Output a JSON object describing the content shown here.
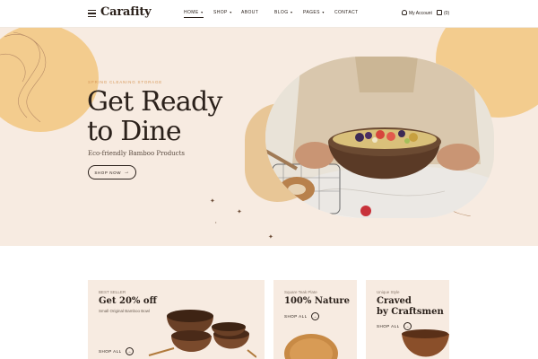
{
  "header": {
    "logo": "Carafity",
    "nav": [
      {
        "label": "HOME",
        "dropdown": true,
        "active": true
      },
      {
        "label": "SHOP",
        "dropdown": true,
        "active": false
      },
      {
        "label": "ABOUT",
        "dropdown": false,
        "active": false
      },
      {
        "label": "BLOG",
        "dropdown": true,
        "active": false
      },
      {
        "label": "PAGES",
        "dropdown": true,
        "active": false
      },
      {
        "label": "CONTACT",
        "dropdown": false,
        "active": false
      }
    ],
    "account_label": "My Account",
    "cart_count": "(0)"
  },
  "hero": {
    "eyebrow": "SPRING CLEANING STORAGE",
    "headline_line1": "Get Ready",
    "headline_line2": "to Dine",
    "subline": "Eco-friendly Bamboo Products",
    "button_label": "SHOP NOW"
  },
  "cards": [
    {
      "label": "BEST SELLER",
      "title": "Get 20% off",
      "desc": "Small Original Bamboo Bowl",
      "button": "SHOP ALL"
    },
    {
      "label": "Square Teak Plate",
      "title": "100% Nature",
      "button": "SHOP ALL"
    },
    {
      "label": "Unique Style",
      "title_line1": "Craved",
      "title_line2": "by Craftsmen",
      "button": "SHOP ALL"
    }
  ],
  "colors": {
    "accent": "#f3cc8e",
    "hero_bg": "#f7ebe1",
    "text": "#2b211b",
    "eyebrow": "#d89a5c"
  },
  "icons": [
    "hamburger-icon",
    "user-icon",
    "cart-icon",
    "chevron-down-icon",
    "arrow-right-icon"
  ]
}
